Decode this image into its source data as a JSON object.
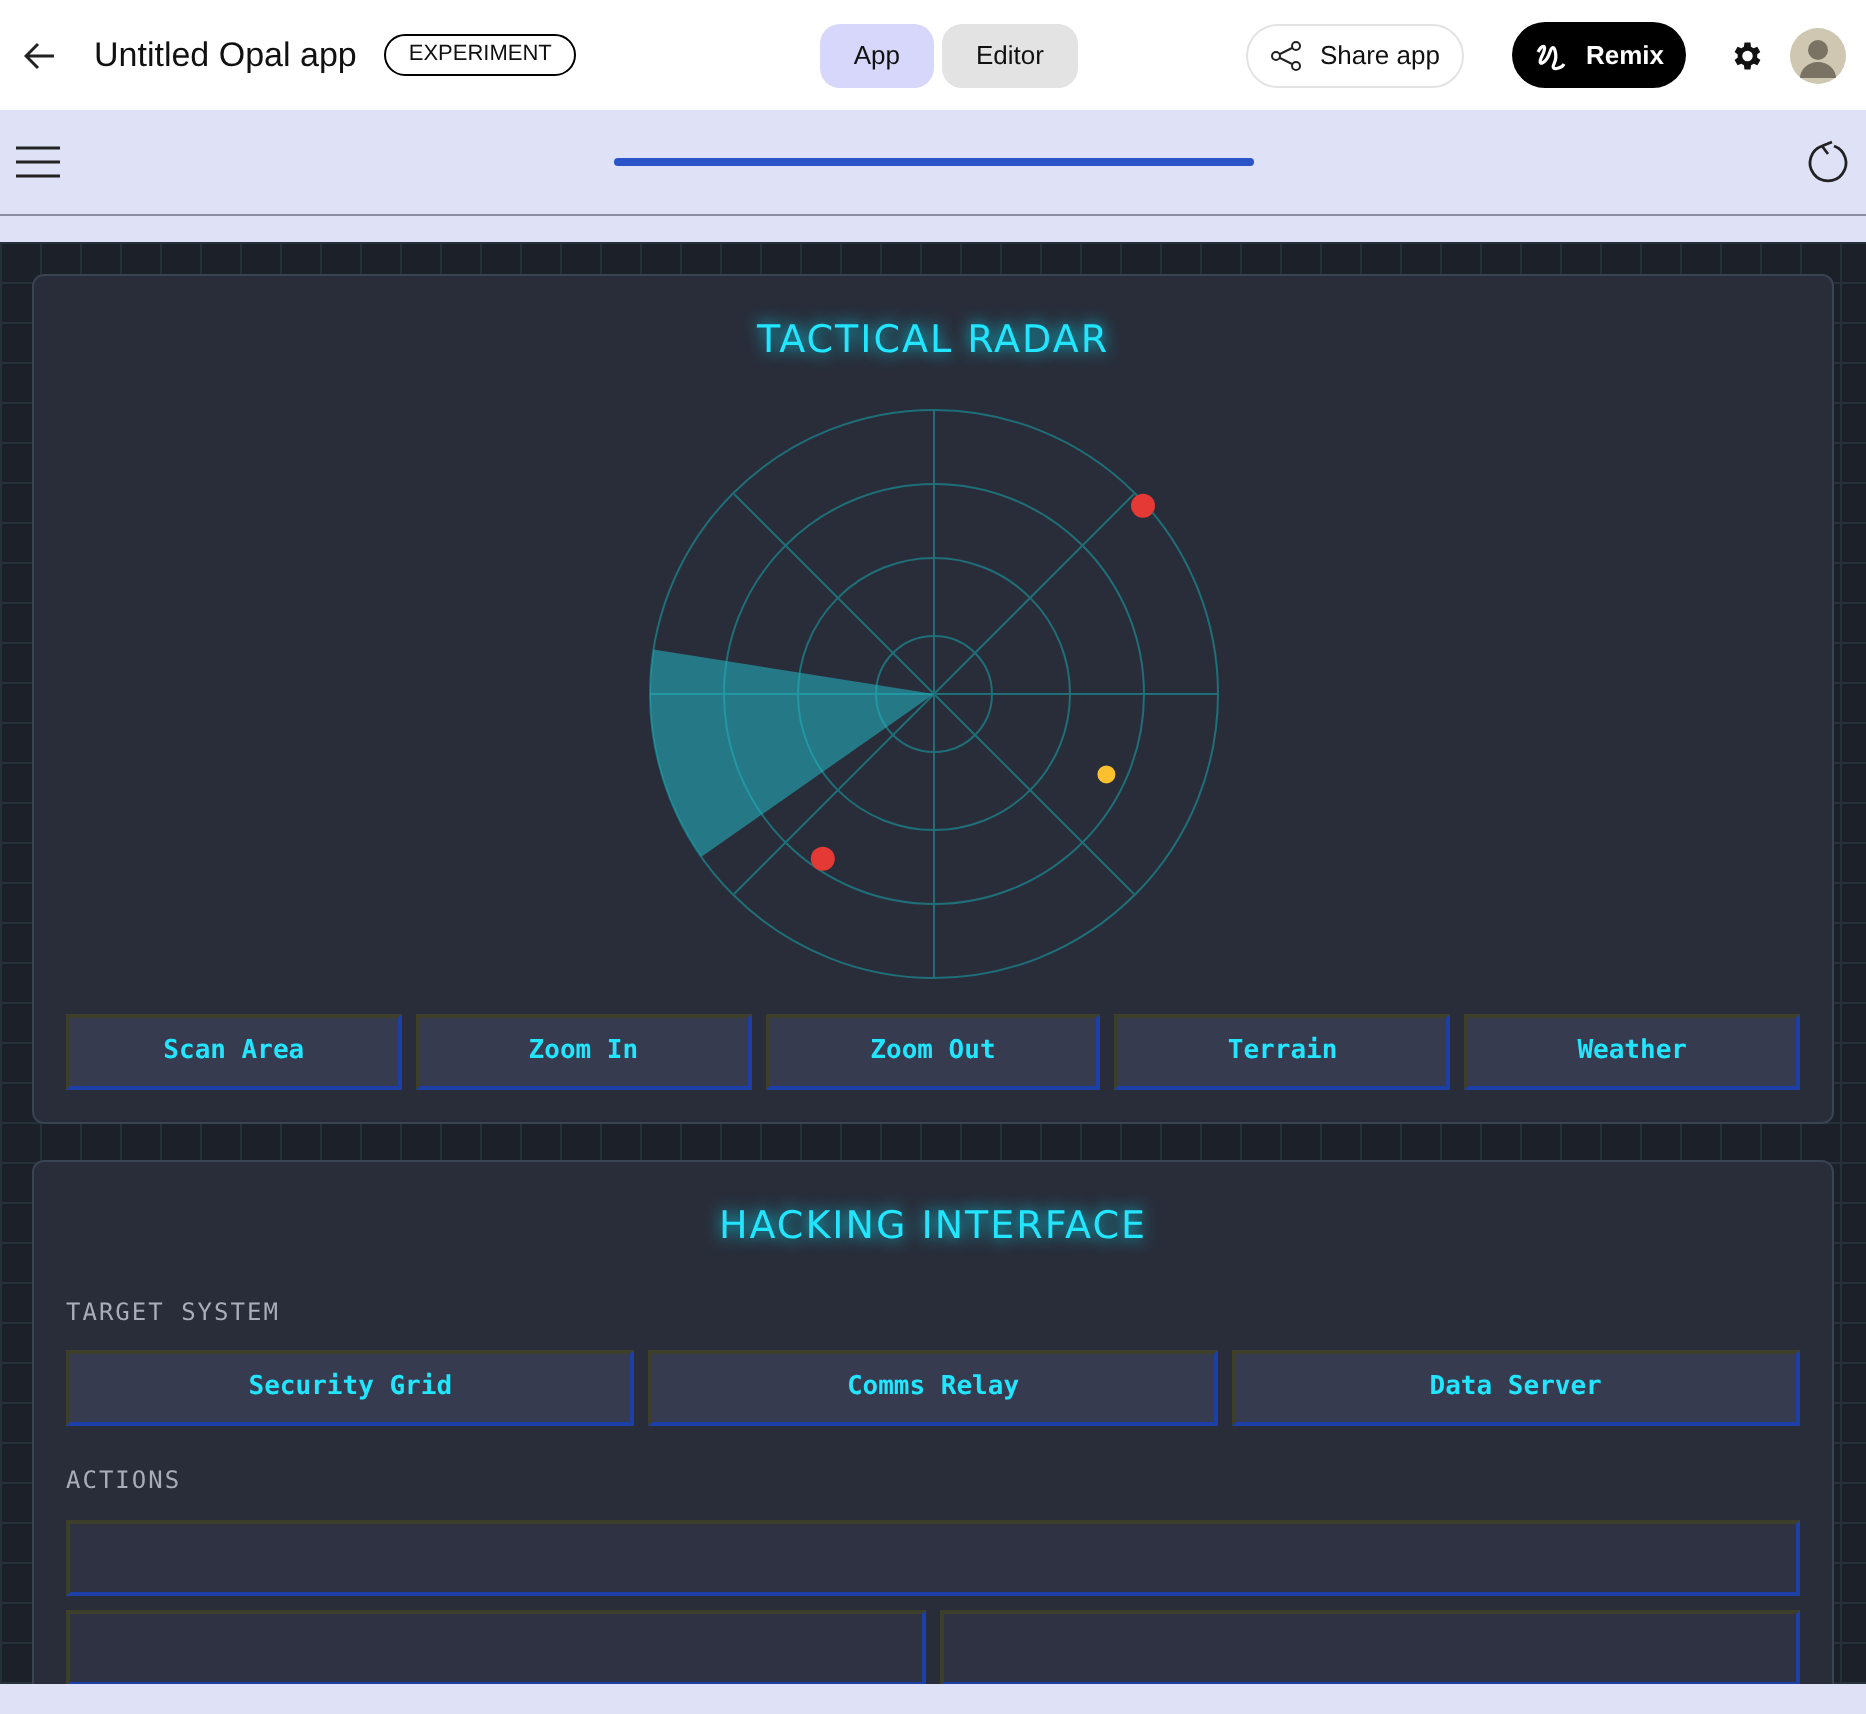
{
  "header": {
    "title": "Untitled Opal app",
    "badge": "EXPERIMENT",
    "view_tabs": [
      {
        "label": "App",
        "selected": true
      },
      {
        "label": "Editor",
        "selected": false
      }
    ],
    "share_label": "Share app",
    "remix_label": "Remix"
  },
  "toolbar": {
    "progress": {
      "level": 1
    }
  },
  "radar_panel": {
    "title": "TACTICAL RADAR",
    "blips": [
      {
        "color": "#e53935"
      },
      {
        "color": "#fbc02d"
      },
      {
        "color": "#e53935"
      }
    ],
    "buttons": [
      "Scan Area",
      "Zoom In",
      "Zoom Out",
      "Terrain",
      "Weather"
    ]
  },
  "hacking_panel": {
    "title": "HACKING INTERFACE",
    "target_label": "TARGET SYSTEM",
    "targets": [
      "Security Grid",
      "Comms Relay",
      "Data Server"
    ],
    "actions_label": "ACTIONS"
  }
}
